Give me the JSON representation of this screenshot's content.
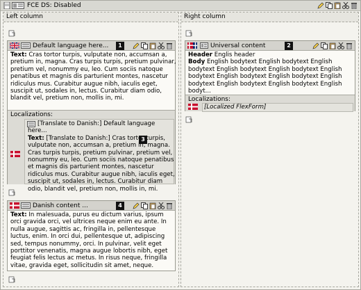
{
  "page": {
    "title": "FCE DS: Disabled"
  },
  "columns": {
    "left": "Left column",
    "right": "Right column"
  },
  "badges": [
    "1",
    "2",
    "3",
    "4"
  ],
  "elements": {
    "default_language": {
      "title": "Default language here...",
      "text_label": "Text:",
      "lines": [
        "Cras tortor turpis, vulputate non, accumsan a,",
        "pretium in, magna. Cras turpis turpis, pretium pulvinar,",
        "pretium vel, nonummy eu, leo. Cum sociis natoque",
        "penatibus et magnis dis parturient montes, nascetur",
        "ridiculus mus. Curabitur augue nibh, iaculis eget,",
        "suscipit ut, sodales in, lectus. Curabitur diam odio,",
        "blandit vel, pretium non, mollis in, mi."
      ],
      "localizations_label": "Localizations:",
      "translation": {
        "title_line1": "[Translate to Danish:] Default language",
        "title_line2": "here...",
        "text_label": "Text:",
        "lines": [
          "[Translate to Danish:] Cras tortor turpis,",
          "vulputate non, accumsan a, pretium in, magna.",
          "Cras turpis turpis, pretium pulvinar, pretium vel,",
          "nonummy eu, leo. Cum sociis natoque penatibus",
          "et magnis dis parturient montes, nascetur",
          "ridiculus mus. Curabitur augue nibh, iaculis eget,",
          "suscipit ut, sodales in, lectus. Curabitur diam",
          "odio, blandit vel, pretium non, mollis in, mi."
        ]
      }
    },
    "danish_content": {
      "title": "Danish content ...",
      "text_label": "Text:",
      "lines": [
        "In malesuada, purus eu dictum varius, ipsum",
        "orci gravida orci, vel ultrices neque enim eu ante. In",
        "nulla augue, sagittis ac, fringilla in, pellentesque",
        "luctus, enim. In orci dui, pellentesque ut, adipiscing",
        "sed, tempus nonummy, orci. In pulvinar, velit eget",
        "porttitor venenatis, magna augue lobortis nibh, eget",
        "feugiat felis lectus ac metus. In risus neque, fringilla",
        "vitae, gravida eget, sollicitudin sit amet, neque."
      ]
    },
    "universal_content": {
      "title": "Universal content",
      "header_label": "Header",
      "header_value": "Englis header",
      "body_label": "Body",
      "body_lines": [
        "English bodytext English bodytext English",
        "bodytext English bodytext English bodytext English",
        "bodytext English bodytext English bodytext English",
        "bodytext English bodytext English bodytext English",
        "bodyt..."
      ],
      "localizations_label": "Localizations:",
      "localized_item": "[Localized FlexForm]"
    }
  },
  "icons": {
    "page_icons": [
      "edit-icon",
      "copy-icon",
      "paste-icon",
      "cut-icon",
      "delete-icon"
    ],
    "element_actions": [
      "edit-icon",
      "copy-icon",
      "paste-icon",
      "cut-icon",
      "delete-icon"
    ]
  },
  "colors": {
    "danish_flag_red": "#c8102e",
    "uk_flag_blue": "#012169",
    "badge": "#111111"
  }
}
